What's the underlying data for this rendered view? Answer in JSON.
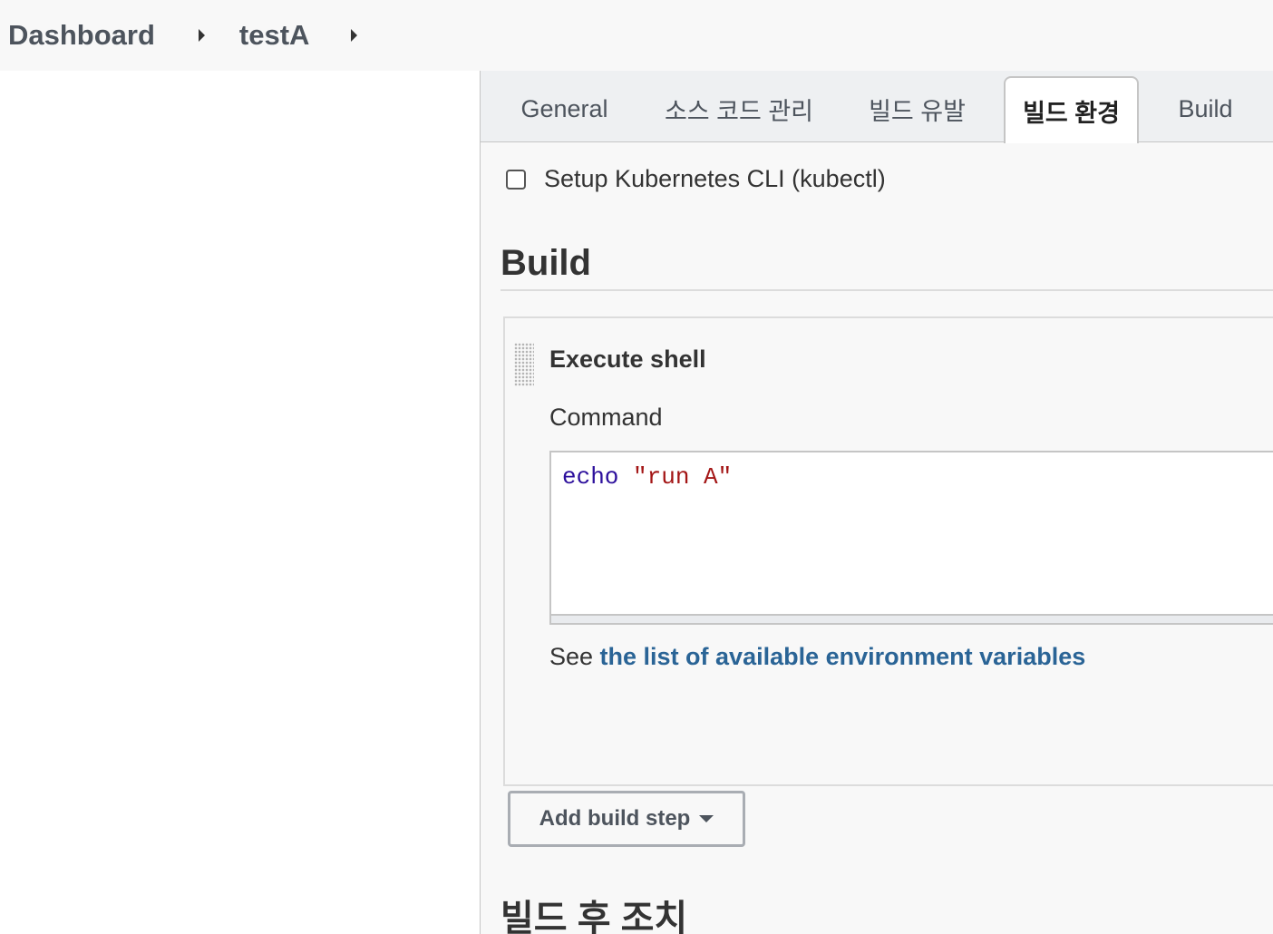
{
  "breadcrumb": {
    "items": [
      "Dashboard",
      "testA"
    ]
  },
  "tabs": [
    {
      "label": "General",
      "active": false
    },
    {
      "label": "소스 코드 관리",
      "active": false
    },
    {
      "label": "빌드 유발",
      "active": false
    },
    {
      "label": "빌드 환경",
      "active": true
    },
    {
      "label": "Build",
      "active": false
    }
  ],
  "build_env": {
    "kubectl_option": {
      "label": "Setup Kubernetes CLI (kubectl)",
      "checked": false
    }
  },
  "build_section": {
    "title": "Build",
    "step": {
      "title": "Execute shell",
      "command_label": "Command",
      "command_keyword": "echo",
      "command_string": "\"run A\"",
      "help_prefix": "See ",
      "help_link": "the list of available environment variables"
    },
    "add_button_label": "Add build step"
  },
  "post_build": {
    "title": "빌드 후 조치"
  },
  "colors": {
    "link": "#2a6496",
    "code_keyword": "#2c0f9c",
    "code_string": "#a31515"
  }
}
